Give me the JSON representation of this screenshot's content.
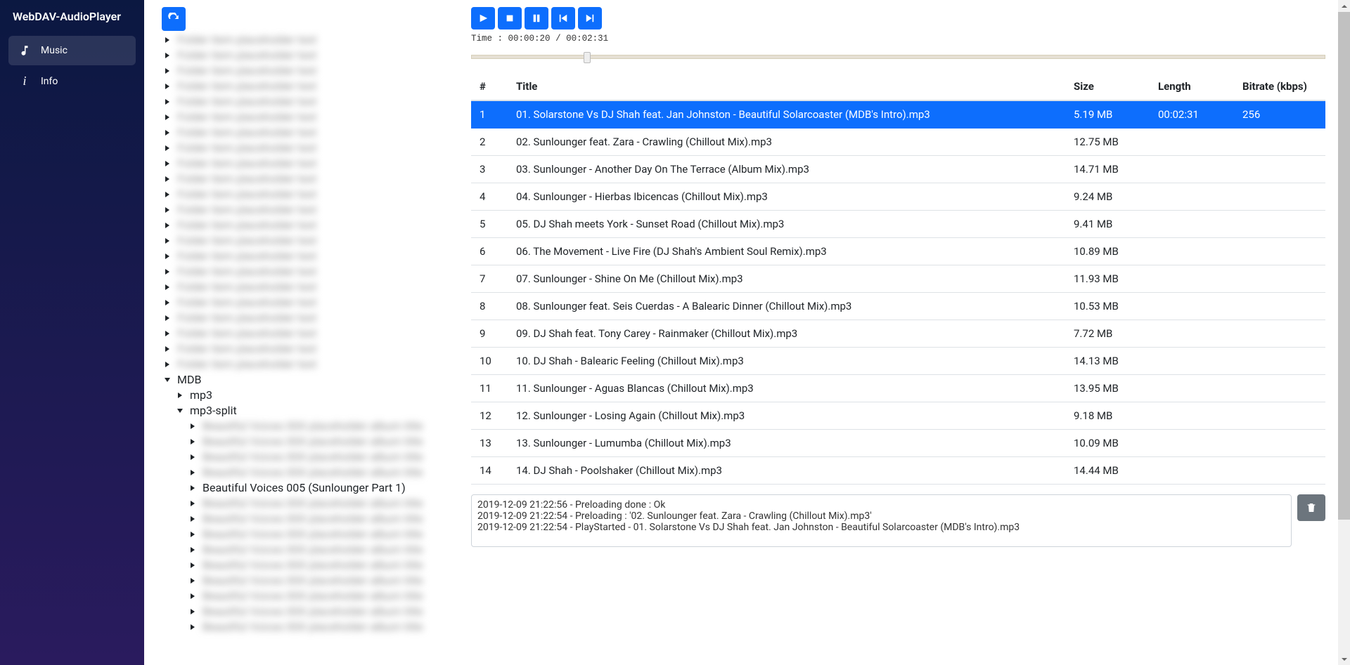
{
  "brand": "WebDAV-AudioPlayer",
  "nav": {
    "music": "Music",
    "info": "Info"
  },
  "tree": {
    "blurred_top_count": 22,
    "mdb": "MDB",
    "mp3": "mp3",
    "mp3split": "mp3-split",
    "sub_blur_before": 4,
    "beautiful": "Beautiful Voices 005 (Sunlounger Part 1)",
    "sub_blur_after": 9
  },
  "player": {
    "time_label": "Time :",
    "time_current": "00:00:20",
    "time_sep": "/",
    "time_total": "00:02:31",
    "progress_pct": 13.2
  },
  "columns": {
    "num": "#",
    "title": "Title",
    "size": "Size",
    "length": "Length",
    "bitrate": "Bitrate (kbps)"
  },
  "tracks": [
    {
      "n": "1",
      "title": "01. Solarstone Vs DJ Shah feat. Jan Johnston - Beautiful Solarcoaster (MDB's Intro).mp3",
      "size": "5.19 MB",
      "len": "00:02:31",
      "rate": "256",
      "sel": true
    },
    {
      "n": "2",
      "title": "02. Sunlounger feat. Zara - Crawling (Chillout Mix).mp3",
      "size": "12.75 MB",
      "len": "",
      "rate": ""
    },
    {
      "n": "3",
      "title": "03. Sunlounger - Another Day On The Terrace (Album Mix).mp3",
      "size": "14.71 MB",
      "len": "",
      "rate": ""
    },
    {
      "n": "4",
      "title": "04. Sunlounger - Hierbas Ibicencas (Chillout Mix).mp3",
      "size": "9.24 MB",
      "len": "",
      "rate": ""
    },
    {
      "n": "5",
      "title": "05. DJ Shah meets York - Sunset Road (Chillout Mix).mp3",
      "size": "9.41 MB",
      "len": "",
      "rate": ""
    },
    {
      "n": "6",
      "title": "06. The Movement - Live Fire (DJ Shah's Ambient Soul Remix).mp3",
      "size": "10.89 MB",
      "len": "",
      "rate": ""
    },
    {
      "n": "7",
      "title": "07. Sunlounger - Shine On Me (Chillout Mix).mp3",
      "size": "11.93 MB",
      "len": "",
      "rate": ""
    },
    {
      "n": "8",
      "title": "08. Sunlounger feat. Seis Cuerdas - A Balearic Dinner (Chillout Mix).mp3",
      "size": "10.53 MB",
      "len": "",
      "rate": ""
    },
    {
      "n": "9",
      "title": "09. DJ Shah feat. Tony Carey - Rainmaker (Chillout Mix).mp3",
      "size": "7.72 MB",
      "len": "",
      "rate": ""
    },
    {
      "n": "10",
      "title": "10. DJ Shah - Balearic Feeling (Chillout Mix).mp3",
      "size": "14.13 MB",
      "len": "",
      "rate": ""
    },
    {
      "n": "11",
      "title": "11. Sunlounger - Aguas Blancas (Chillout Mix).mp3",
      "size": "13.95 MB",
      "len": "",
      "rate": ""
    },
    {
      "n": "12",
      "title": "12. Sunlounger - Losing Again (Chillout Mix).mp3",
      "size": "9.18 MB",
      "len": "",
      "rate": ""
    },
    {
      "n": "13",
      "title": "13. Sunlounger - Lumumba (Chillout Mix).mp3",
      "size": "10.09 MB",
      "len": "",
      "rate": ""
    },
    {
      "n": "14",
      "title": "14. DJ Shah - Poolshaker (Chillout Mix).mp3",
      "size": "14.44 MB",
      "len": "",
      "rate": ""
    }
  ],
  "log": [
    "2019-12-09 21:22:56 - Preloading done : Ok",
    "2019-12-09 21:22:54 - Preloading : '02. Sunlounger feat. Zara - Crawling (Chillout Mix).mp3'",
    "2019-12-09 21:22:54 - PlayStarted - 01. Solarstone Vs DJ Shah feat. Jan Johnston - Beautiful Solarcoaster (MDB's Intro).mp3"
  ]
}
